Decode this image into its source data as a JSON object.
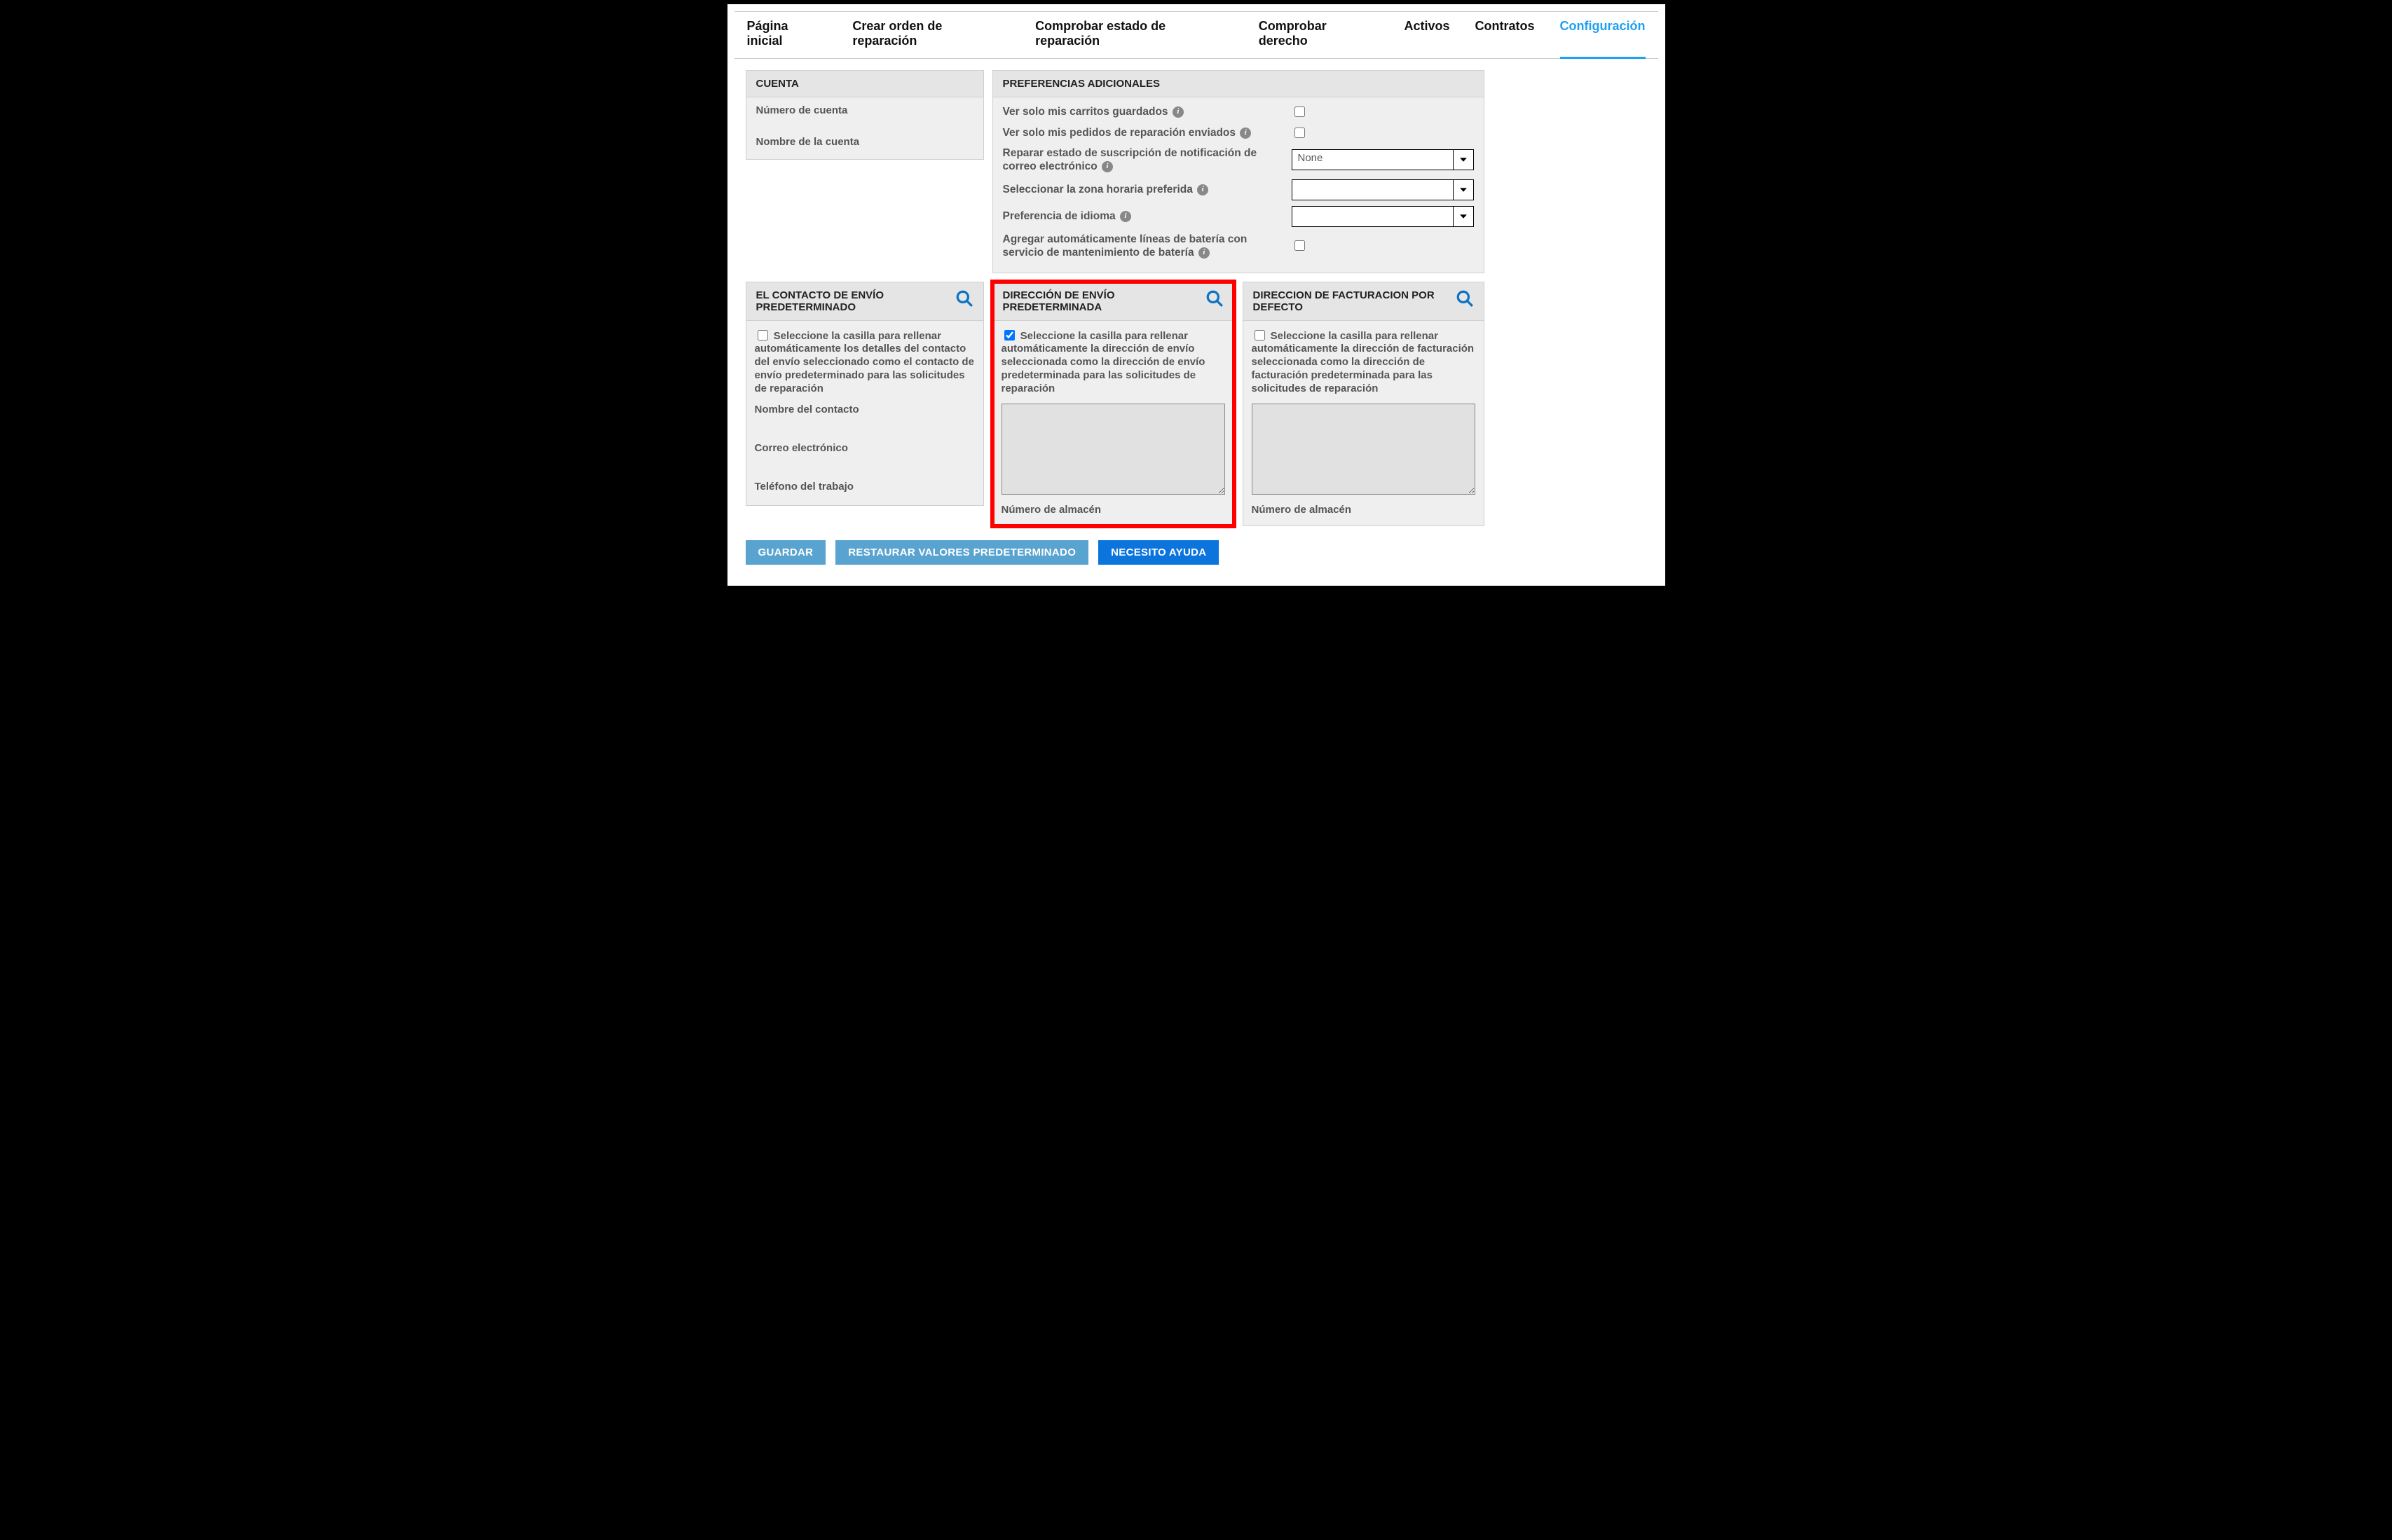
{
  "tabs": {
    "home": "Página inicial",
    "create": "Crear orden de reparación",
    "check_status": "Comprobar estado de reparación",
    "check_right": "Comprobar derecho",
    "assets": "Activos",
    "contracts": "Contratos",
    "config": "Configuración"
  },
  "account": {
    "title": "CUENTA",
    "number_label": "Número de cuenta",
    "name_label": "Nombre de la cuenta"
  },
  "prefs": {
    "title": "PREFERENCIAS ADICIONALES",
    "only_my_carts": "Ver solo mis carritos guardados",
    "only_my_orders": "Ver solo mis pedidos de reparación enviados",
    "notif_status": "Reparar estado de suscripción de notificación de correo electrónico",
    "notif_value": "None",
    "timezone": "Seleccionar la zona horaria preferida",
    "timezone_value": "",
    "language": "Preferencia de idioma",
    "language_value": "",
    "auto_battery": "Agregar automáticamente líneas de batería con servicio de mantenimiento de batería"
  },
  "ship_contact": {
    "title": "EL CONTACTO DE ENVÍO PREDETERMINADO",
    "checkbox_text": "Seleccione la casilla para rellenar automáticamente los detalles del contacto del envío seleccionado como el contacto de envío predeterminado para las solicitudes de reparación",
    "contact_name": "Nombre del contacto",
    "email": "Correo electrónico",
    "phone": "Teléfono del trabajo"
  },
  "ship_addr": {
    "title": "DIRECCIÓN DE ENVÍO PREDETERMINADA",
    "checkbox_text": "Seleccione la casilla para rellenar automáticamente la dirección de envío seleccionada como la dirección de envío predeterminada para las solicitudes de reparación",
    "checked": true,
    "warehouse": "Número de almacén"
  },
  "bill_addr": {
    "title": "DIRECCION DE FACTURACION POR DEFECTO",
    "checkbox_text": "Seleccione la casilla para rellenar automáticamente la dirección de facturación seleccionada como la dirección de facturación predeterminada para las solicitudes de reparación",
    "checked": false,
    "warehouse": "Número de almacén"
  },
  "buttons": {
    "save": "GUARDAR",
    "restore": "RESTAURAR VALORES PREDETERMINADO",
    "help": "NECESITO AYUDA"
  }
}
